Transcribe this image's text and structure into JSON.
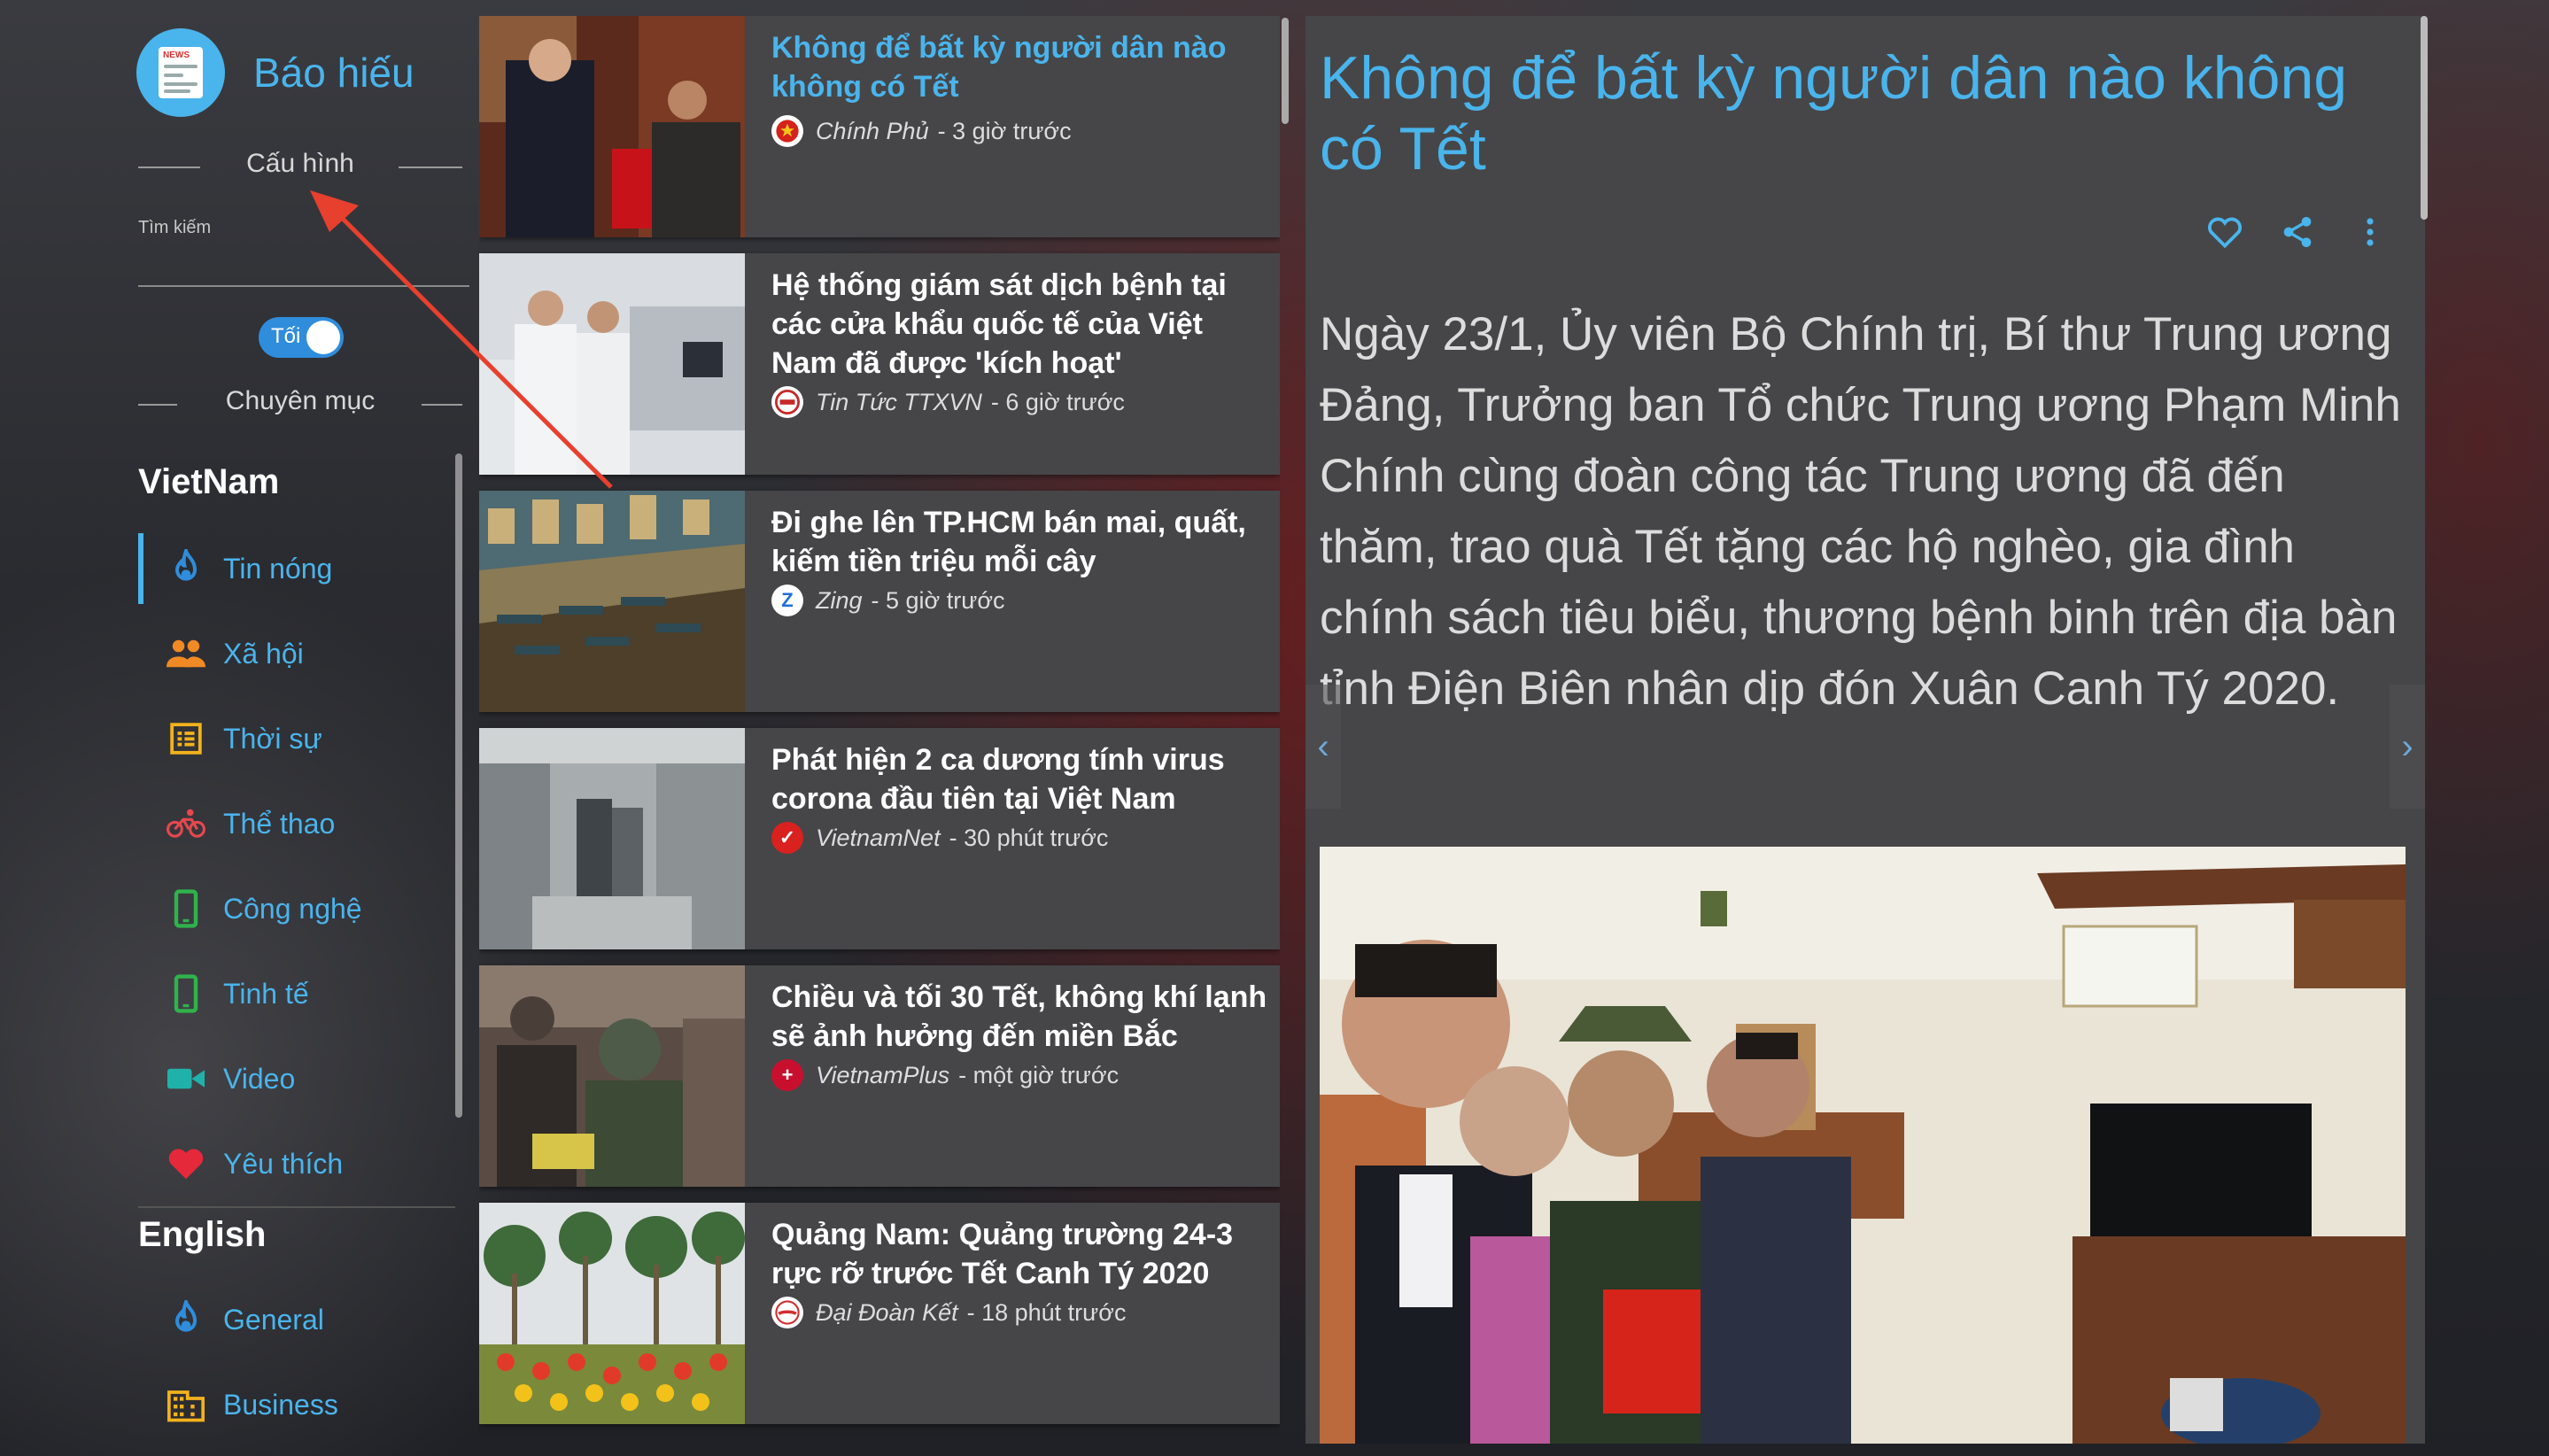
{
  "app": {
    "title": "Báo hiếu"
  },
  "sidebar": {
    "config_label": "Cấu hình",
    "search_label": "Tìm kiếm",
    "search_value": "",
    "toggle_label": "Tối",
    "categories_label": "Chuyên mục",
    "sections": [
      {
        "title": "VietNam",
        "items": [
          {
            "label": "Tin nóng",
            "icon": "fire-icon",
            "color": "#2f8ddc",
            "active": true
          },
          {
            "label": "Xã hội",
            "icon": "people-icon",
            "color": "#f08a24"
          },
          {
            "label": "Thời sự",
            "icon": "list-icon",
            "color": "#f2b21c"
          },
          {
            "label": "Thể thao",
            "icon": "bike-icon",
            "color": "#e5484d"
          },
          {
            "label": "Công nghệ",
            "icon": "phone-icon",
            "color": "#2fb34b"
          },
          {
            "label": "Tinh tế",
            "icon": "phone-icon",
            "color": "#2fb34b"
          },
          {
            "label": "Video",
            "icon": "video-camera-icon",
            "color": "#20b2aa"
          },
          {
            "label": "Yêu thích",
            "icon": "heart-icon",
            "color": "#e5293a"
          }
        ]
      },
      {
        "title": "English",
        "items": [
          {
            "label": "General",
            "icon": "fire-icon",
            "color": "#2f8ddc"
          },
          {
            "label": "Business",
            "icon": "building-icon",
            "color": "#f2b21c"
          }
        ]
      }
    ]
  },
  "news": [
    {
      "title": "Không để bất kỳ người dân nào không có Tết",
      "source": "Chính Phủ",
      "time": "- 3 giờ trước",
      "source_icon": "gov-emblem-icon",
      "selected": true
    },
    {
      "title": "Hệ thống giám sát dịch bệnh tại các cửa khẩu quốc tế của Việt Nam đã được 'kích hoạt'",
      "source": "Tin Tức TTXVN",
      "time": "- 6 giờ trước",
      "source_icon": "ttxvn-icon"
    },
    {
      "title": "Đi ghe lên TP.HCM bán mai, quất, kiếm tiền triệu mỗi cây",
      "source": "Zing",
      "time": "- 5 giờ trước",
      "source_icon": "zing-icon"
    },
    {
      "title": "Phát hiện 2 ca dương tính virus corona đầu tiên tại Việt Nam",
      "source": "VietnamNet",
      "time": "- 30 phút trước",
      "source_icon": "vietnamnet-icon"
    },
    {
      "title": "Chiều và tối 30 Tết, không khí lạnh sẽ ảnh hưởng đến miền Bắc",
      "source": "VietnamPlus",
      "time": "- một giờ trước",
      "source_icon": "vietnamplus-icon"
    },
    {
      "title": "Quảng Nam: Quảng trường 24-3 rực rỡ trước Tết Canh Tý 2020",
      "source": "Đại Đoàn Kết",
      "time": "- 18 phút trước",
      "source_icon": "daidoanket-icon"
    }
  ],
  "article": {
    "title": "Không để bất kỳ người dân nào không có Tết",
    "body": "Ngày 23/1, Ủy viên Bộ Chính trị, Bí thư Trung ương Đảng, Trưởng ban Tổ chức Trung ương Phạm Minh Chính cùng đoàn công tác Trung ương đã đến thăm, trao quà Tết tặng các hộ nghèo, gia đình chính sách tiêu biểu, thương bệnh binh trên địa bàn tỉnh Điện Biên nhân dịp đón Xuân Canh Tý 2020."
  },
  "colors": {
    "accent": "#4ab4ec",
    "card": "#464648",
    "annotation_arrow": "#e8402e"
  }
}
